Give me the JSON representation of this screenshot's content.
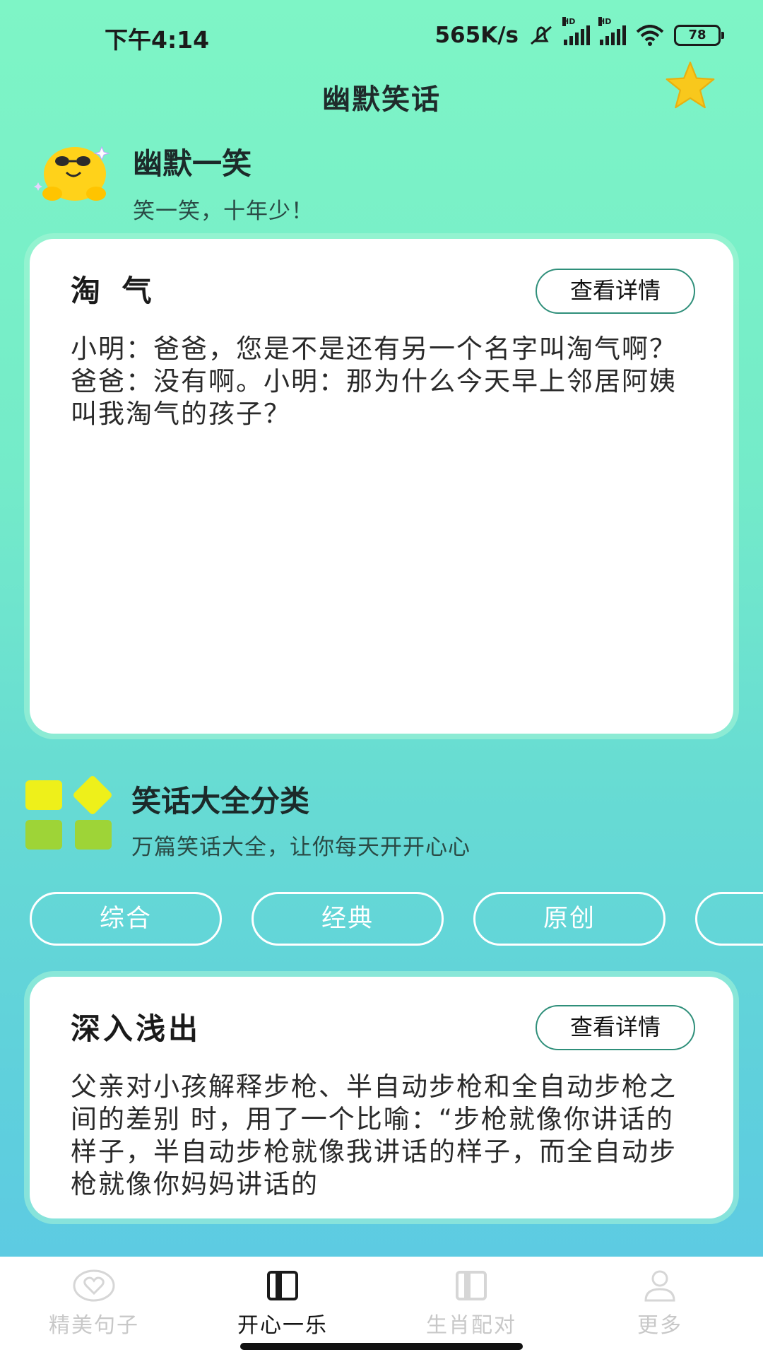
{
  "status_bar": {
    "time": "下午4:14",
    "speed": "565K/s",
    "battery": "78",
    "icons": [
      "mute-icon",
      "signal-hd-icon",
      "signal-hd-icon",
      "wifi-icon",
      "battery-icon"
    ]
  },
  "header": {
    "title": "幽默笑话",
    "favorite_icon": "star-icon",
    "accent": "#f8c81c"
  },
  "hero": {
    "title": "幽默一笑",
    "subtitle": "笑一笑，十年少！",
    "icon": "smiley-emoji-icon"
  },
  "featured_card": {
    "title": "淘 气",
    "button": "查看详情",
    "body": "小明：爸爸，您是不是还有另一个名字叫淘气啊？爸爸：没有啊。小明：那为什么今天早上邻居阿姨叫我淘气的孩子？"
  },
  "categories": {
    "title": "笑话大全分类",
    "subtitle": "万篇笑话大全，让你每天开开心心",
    "icon": "category-tiles-icon",
    "chips": [
      "综合",
      "经典",
      "原创",
      ""
    ]
  },
  "second_card": {
    "title": "深入浅出",
    "button": "查看详情",
    "body": "父亲对小孩解释步枪、半自动步枪和全自动步枪之间的差别 时，用了一个比喻：“步枪就像你讲话的样子，半自动步枪就像我讲话的样子，而全自动步枪就像你妈妈讲话的"
  },
  "tabbar": {
    "items": [
      {
        "label": "精美句子",
        "icon": "heart-icon"
      },
      {
        "label": "开心一乐",
        "icon": "book-icon"
      },
      {
        "label": "生肖配对",
        "icon": "book-icon"
      },
      {
        "label": "更多",
        "icon": "user-icon"
      }
    ],
    "active_index": 1
  }
}
